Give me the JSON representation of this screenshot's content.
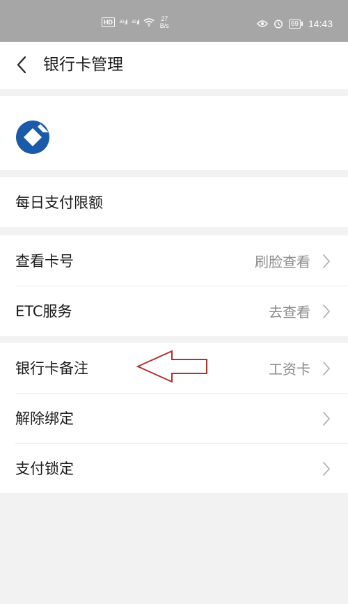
{
  "status_bar": {
    "hd": "HD",
    "signal_a": "⁴ᴳ.ıll",
    "signal_b": "⁴ᴳ.ıll",
    "speed_value": "27",
    "speed_unit": "B/s",
    "battery": "69",
    "time": "14:43"
  },
  "nav": {
    "title": "银行卡管理"
  },
  "sections": [
    {
      "rows": [
        {
          "label": "每日支付限额",
          "value": "",
          "has_chevron": false
        }
      ]
    },
    {
      "rows": [
        {
          "label": "查看卡号",
          "value": "刷脸查看",
          "has_chevron": true
        },
        {
          "label": "ETC服务",
          "value": "去查看",
          "has_chevron": true
        }
      ]
    },
    {
      "rows": [
        {
          "label": "银行卡备注",
          "value": "工资卡",
          "has_chevron": true
        },
        {
          "label": "解除绑定",
          "value": "",
          "has_chevron": true
        },
        {
          "label": "支付锁定",
          "value": "",
          "has_chevron": true
        }
      ]
    }
  ],
  "colors": {
    "status_bar_bg": "#a6a6a6",
    "bank_logo": "#1a5aa8",
    "annotation_arrow": "#b3302f",
    "value_text": "#8c8c8c"
  },
  "icons": {
    "back": "chevron-left-icon",
    "logo": "bank-logo-icon",
    "row_chevron": "chevron-right-icon"
  }
}
